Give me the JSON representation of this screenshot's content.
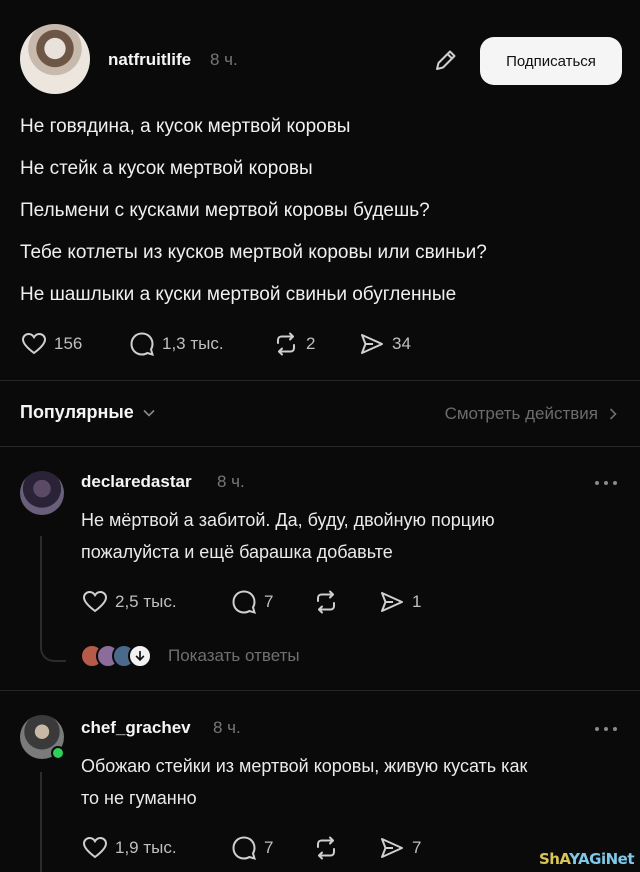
{
  "post": {
    "username": "natfruitlife",
    "time": "8 ч.",
    "subscribe_label": "Подписаться",
    "lines": [
      "Не говядина, а кусок мертвой коровы",
      "Не стейк а кусок мертвой коровы",
      "Пельмени с кусками мертвой коровы будешь?",
      "Тебе котлеты из кусков мертвой коровы или свиньи?",
      "Не шашлыки а куски мертвой свиньи обугленные"
    ],
    "likes": "156",
    "comments": "1,3 тыс.",
    "reposts": "2",
    "shares": "34"
  },
  "filter": {
    "sort_label": "Популярные",
    "view_actions_label": "Смотреть действия"
  },
  "comments": [
    {
      "username": "declaredastar",
      "time": "8 ч.",
      "text_lines": [
        "Не мёртвой а забитой. Да, буду, двойную порцию",
        "пожалуйста и ещё  барашка добавьте"
      ],
      "likes": "2,5 тыс.",
      "replies": "7",
      "reposts": "",
      "shares": "1",
      "show_replies_label": "Показать ответы"
    },
    {
      "username": "chef_grachev",
      "time": "8 ч.",
      "text_lines": [
        "Обожаю стейки из мертвой коровы, живую кусать как",
        "то не гуманно"
      ],
      "likes": "1,9 тыс.",
      "replies": "7",
      "reposts": "",
      "shares": "7"
    }
  ],
  "watermark": {
    "part1": "ShA",
    "part2": "YAGiNet"
  },
  "colors": {
    "background": "#0a0a0a",
    "text": "#f3f3f3",
    "muted": "#777777",
    "online": "#2fd05a",
    "button_bg": "#f5f5f5"
  },
  "icons": [
    "edit-icon",
    "heart-icon",
    "comment-icon",
    "repost-icon",
    "share-icon",
    "chevron-down-icon",
    "chevron-right-icon",
    "more-icon",
    "arrow-down-icon"
  ]
}
